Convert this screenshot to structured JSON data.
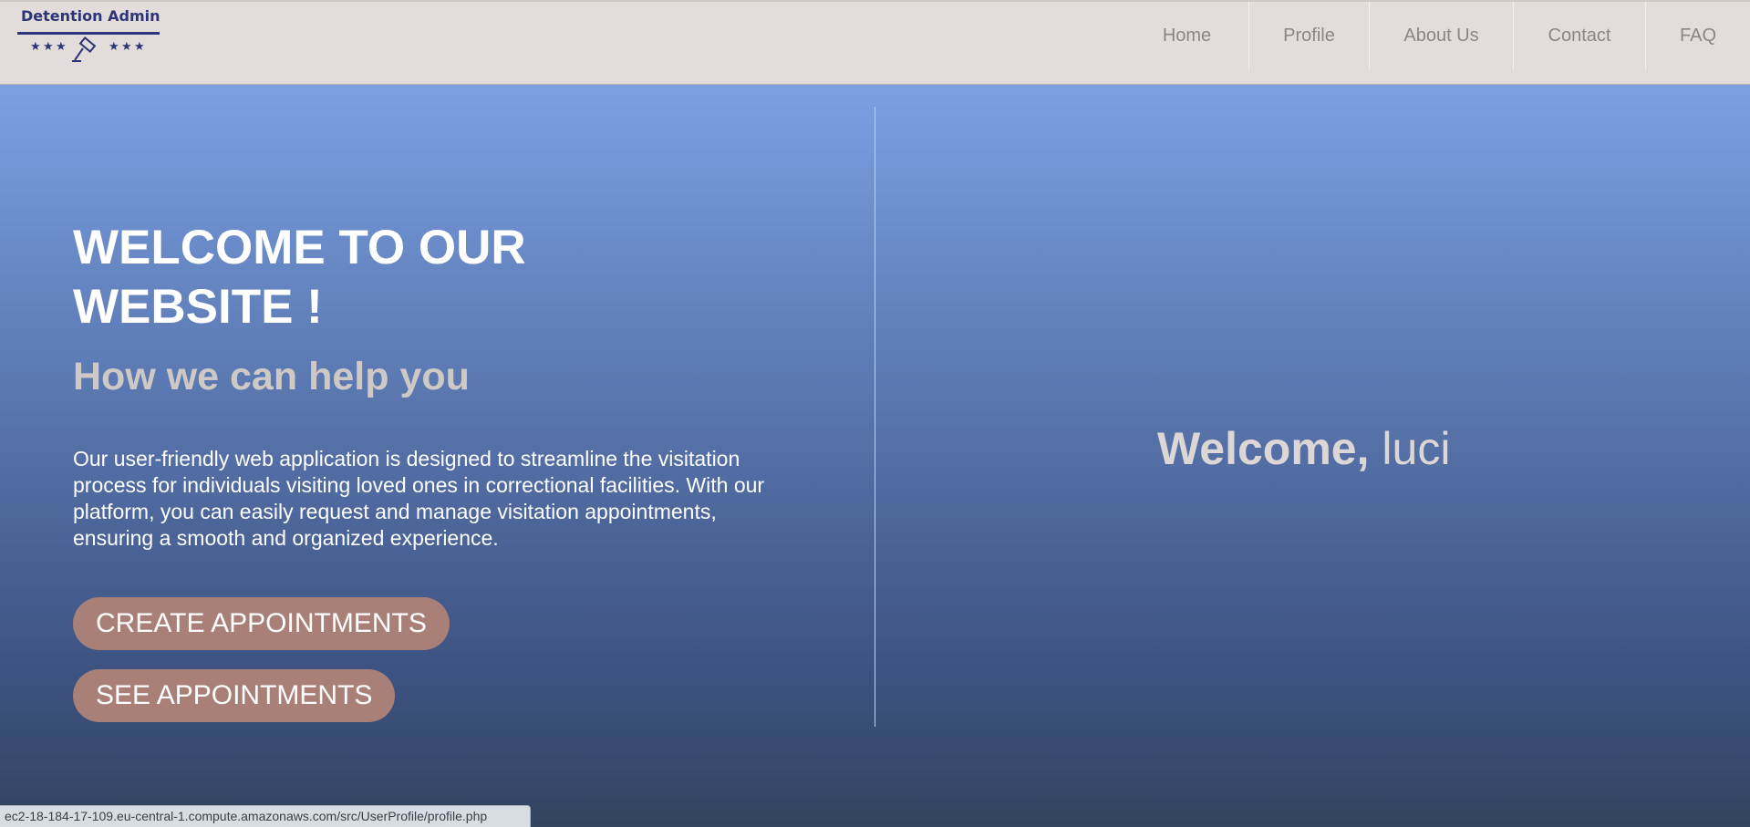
{
  "header": {
    "logo_title": "Detention Admin",
    "nav": [
      {
        "label": "Home"
      },
      {
        "label": "Profile"
      },
      {
        "label": "About Us"
      },
      {
        "label": "Contact"
      },
      {
        "label": "FAQ"
      }
    ]
  },
  "hero": {
    "title": "WELCOME TO OUR WEBSITE !",
    "subtitle": "How we can help you",
    "description": "Our user-friendly web application is designed to streamline the visitation process for individuals visiting loved ones in correctional facilities. With our platform, you can easily request and manage visitation appointments, ensuring a smooth and organized experience.",
    "create_button": "CREATE APPOINTMENTS",
    "see_button": "SEE APPOINTMENTS"
  },
  "welcome": {
    "prefix": "Welcome,",
    "username": "luci"
  },
  "status_bar": {
    "url": "ec2-18-184-17-109.eu-central-1.compute.amazonaws.com/src/UserProfile/profile.php"
  },
  "colors": {
    "header_bg": "#e2dddb",
    "logo_navy": "#2e3478",
    "button_bg": "#a98078",
    "gradient_top": "#7ba0e2",
    "gradient_bottom": "#33445f"
  },
  "icons": {
    "logo": "gavel-icon",
    "stars": "star-icon"
  }
}
